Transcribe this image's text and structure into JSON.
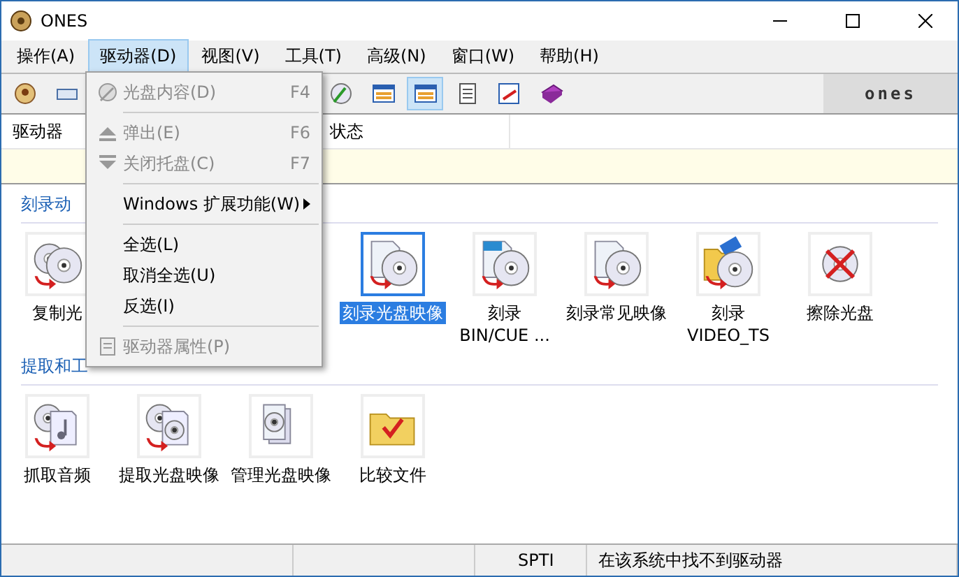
{
  "window": {
    "title": "ONES"
  },
  "menubar": [
    {
      "label": "操作(A)",
      "selected": false
    },
    {
      "label": "驱动器(D)",
      "selected": true
    },
    {
      "label": "视图(V)",
      "selected": false
    },
    {
      "label": "工具(T)",
      "selected": false
    },
    {
      "label": "高级(N)",
      "selected": false
    },
    {
      "label": "窗口(W)",
      "selected": false
    },
    {
      "label": "帮助(H)",
      "selected": false
    }
  ],
  "toolbar": {
    "logo": "ones",
    "buttons": [
      {
        "kind": "app",
        "pressed": false
      },
      {
        "kind": "drive",
        "pressed": false
      },
      {
        "kind": "disc",
        "pressed": false
      },
      {
        "kind": "panel",
        "pressed": false
      },
      {
        "kind": "panel",
        "pressed": true
      },
      {
        "kind": "note",
        "pressed": false
      },
      {
        "kind": "edit",
        "pressed": false
      },
      {
        "kind": "book",
        "pressed": false
      }
    ]
  },
  "drive_list": {
    "columns": [
      "驱动器",
      "状态"
    ]
  },
  "sections": [
    {
      "title": "刻录动",
      "items": [
        {
          "label": "复制光",
          "kind": "copy",
          "selected": false
        },
        {
          "label": "刻录光盘映像",
          "kind": "image",
          "selected": true
        },
        {
          "label": "刻录\nBIN/CUE ...",
          "kind": "cue",
          "selected": false
        },
        {
          "label": "刻录常见映像",
          "kind": "image",
          "selected": false
        },
        {
          "label": "刻录\nVIDEO_TS",
          "kind": "video",
          "selected": false
        },
        {
          "label": "擦除光盘",
          "kind": "erase",
          "selected": false
        }
      ]
    },
    {
      "title": "提取和工",
      "items": [
        {
          "label": "抓取音频",
          "kind": "audio",
          "selected": false
        },
        {
          "label": "提取光盘映像",
          "kind": "extract",
          "selected": false
        },
        {
          "label": "管理光盘映像",
          "kind": "manage",
          "selected": false
        },
        {
          "label": "比较文件",
          "kind": "compare",
          "selected": false
        }
      ]
    }
  ],
  "dropdown": [
    {
      "kind": "item",
      "label": "光盘内容(D)",
      "shortcut": "F4",
      "disabled": true
    },
    {
      "kind": "separator"
    },
    {
      "kind": "item",
      "label": "弹出(E)",
      "shortcut": "F6",
      "disabled": true
    },
    {
      "kind": "item",
      "label": "关闭托盘(C)",
      "shortcut": "F7",
      "disabled": true
    },
    {
      "kind": "separator"
    },
    {
      "kind": "submenu",
      "label": "Windows 扩展功能(W)",
      "disabled": false
    },
    {
      "kind": "separator"
    },
    {
      "kind": "item",
      "label": "全选(L)",
      "disabled": false
    },
    {
      "kind": "item",
      "label": "取消全选(U)",
      "disabled": false
    },
    {
      "kind": "item",
      "label": "反选(I)",
      "disabled": false
    },
    {
      "kind": "separator"
    },
    {
      "kind": "item",
      "label": "驱动器属性(P)",
      "disabled": true
    }
  ],
  "status_bar": [
    "SPTI",
    "在该系统中找不到驱动器"
  ]
}
